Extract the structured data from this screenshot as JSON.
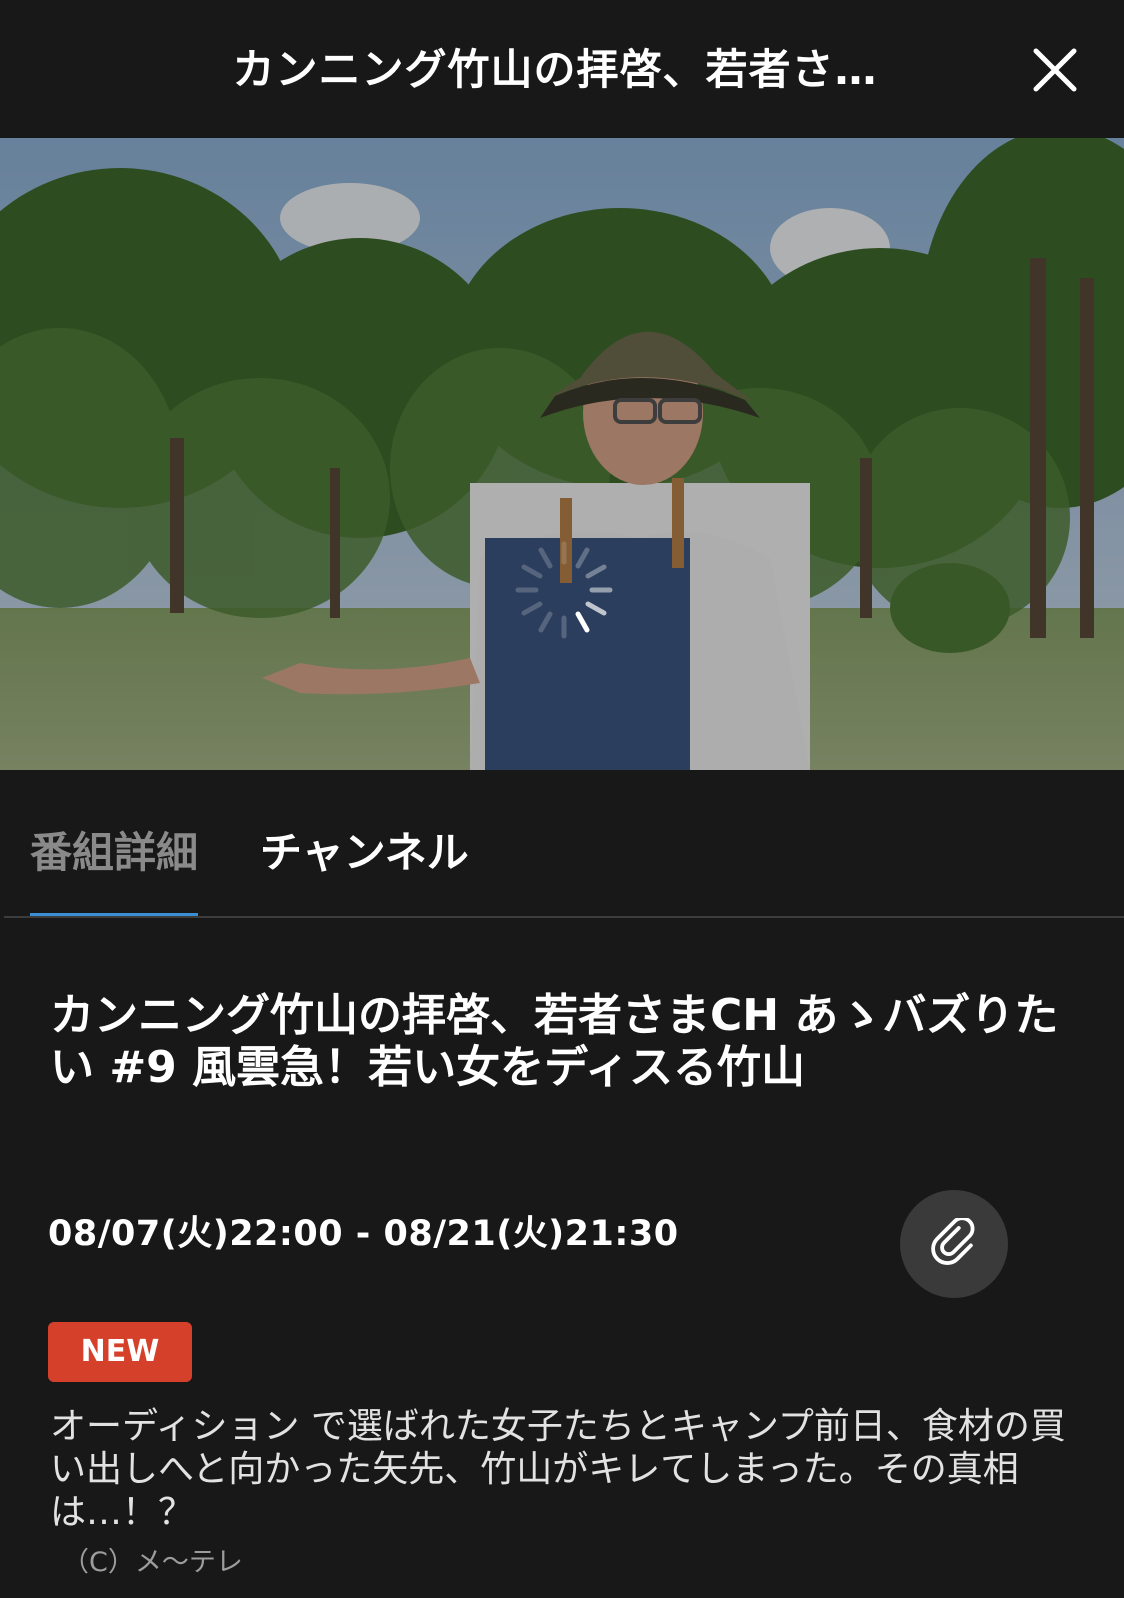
{
  "header": {
    "title": "カンニング竹山の拝啓、若者さ…",
    "close_icon": "close-icon"
  },
  "player": {
    "state": "loading",
    "loading_icon": "loading-spinner-icon"
  },
  "tabs": [
    {
      "label": "番組詳細",
      "selected": true
    },
    {
      "label": "チャンネル",
      "selected": false
    }
  ],
  "program": {
    "title": "カンニング竹山の拝啓、若者さまCH あゝバズりたい #9 風雲急！若い女をディスる竹山",
    "time_range": "08/07(火)22:00 - 08/21(火)21:30",
    "link_icon": "paperclip-icon",
    "badge": "NEW",
    "description": "オーディション で選ばれた女子たちとキャンプ前日、食材の買い出しへと向かった矢先、竹山がキレてしまった。その真相は…！？",
    "copyright": "（C）メ〜テレ"
  },
  "colors": {
    "background": "#181818",
    "tab_indicator": "#3a8fd4",
    "badge": "#d4402a",
    "link_button": "#3a3a3a"
  }
}
